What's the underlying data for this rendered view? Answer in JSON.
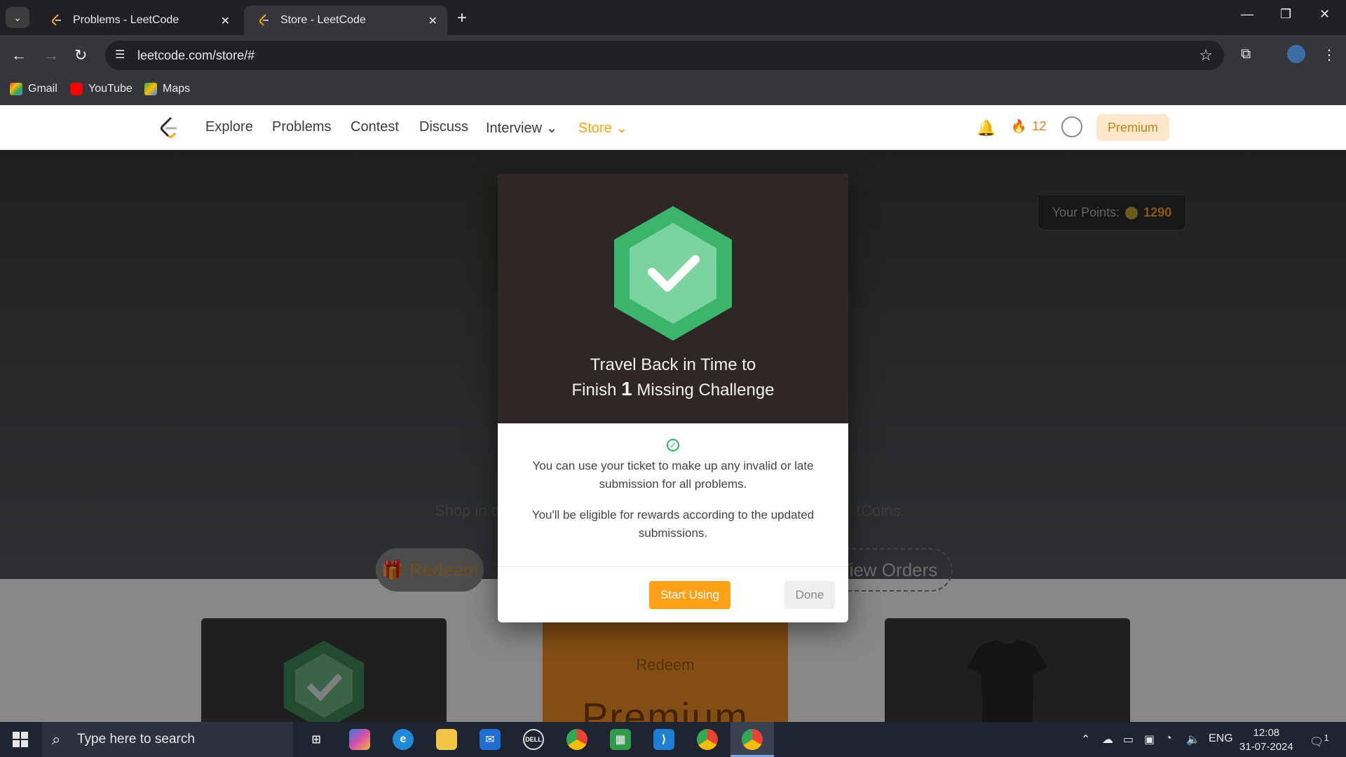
{
  "browser": {
    "tabs": [
      {
        "title": "Problems - LeetCode",
        "active": false
      },
      {
        "title": "Store - LeetCode",
        "active": true
      }
    ],
    "url": "leetcode.com/store/#",
    "bookmarks": [
      "Gmail",
      "YouTube",
      "Maps"
    ]
  },
  "nav": {
    "links": [
      "Explore",
      "Problems",
      "Contest",
      "Discuss",
      "Interview",
      "Store"
    ],
    "streak": "12",
    "premium_label": "Premium"
  },
  "points": {
    "label": "Your Points:",
    "value": "1290"
  },
  "hero": {
    "shop_text_left": "Shop in c",
    "shop_text_right": "tCoins.",
    "redeem_label": "Redeem",
    "orders_label": "View Orders"
  },
  "cards": {
    "redeem_label": "Redeem",
    "premium_label": "Premium"
  },
  "modal": {
    "title_line1": "Travel Back in Time to",
    "title_prefix": "Finish",
    "title_number": "1",
    "title_suffix": "Missing Challenge",
    "text1": "You can use your ticket to make up any invalid or late submission for all problems.",
    "text2": "You'll be eligible for rewards according to the updated submissions.",
    "start_label": "Start Using",
    "done_label": "Done"
  },
  "taskbar": {
    "search_placeholder": "Type here to search",
    "language": "ENG",
    "time": "12:08",
    "date": "31-07-2024",
    "notification_count": "1"
  },
  "colors": {
    "accent": "#ffa116",
    "success": "#2db55d",
    "modal_header": "#2e2725"
  }
}
